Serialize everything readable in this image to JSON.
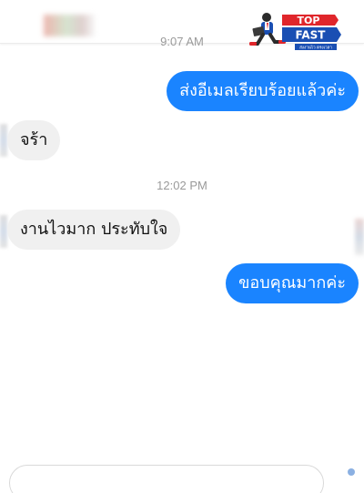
{
  "timestamps": {
    "top": "9:07 AM",
    "middle": "12:02 PM"
  },
  "messages": [
    {
      "direction": "outgoing",
      "text": "ส่งอีเมลเรียบร้อยแล้วค่ะ"
    },
    {
      "direction": "incoming",
      "text": "จร้า"
    },
    {
      "direction": "incoming",
      "text": "งานไวมาก ประทับใจ"
    },
    {
      "direction": "outgoing",
      "text": "ขอบคุณมากค่ะ"
    }
  ],
  "logo": {
    "line1": "TOP",
    "line2": "FAST",
    "tagline": "ส่งงานไว ตรงเวลา"
  },
  "colors": {
    "outgoing_bubble": "#1a84ff",
    "incoming_bubble": "#f0f0f0",
    "logo_blue": "#1a4fb3",
    "logo_red": "#e0262b"
  }
}
